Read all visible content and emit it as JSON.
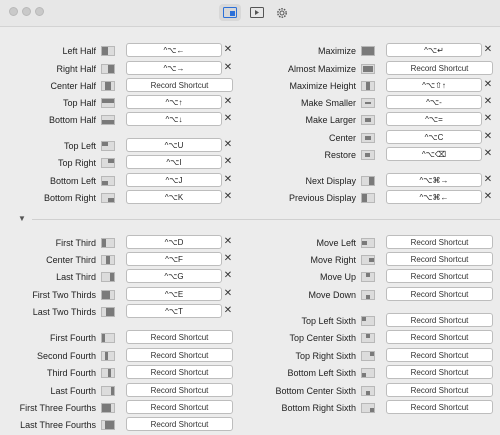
{
  "left_column": [
    {
      "label": "Left Half",
      "icon": "left-half",
      "shortcut": "^⌥←",
      "clearable": true
    },
    {
      "label": "Right Half",
      "icon": "right-half",
      "shortcut": "^⌥→",
      "clearable": true
    },
    {
      "label": "Center Half",
      "icon": "center-half",
      "shortcut": "Record Shortcut",
      "clearable": false
    },
    {
      "label": "Top Half",
      "icon": "top-half",
      "shortcut": "^⌥↑",
      "clearable": true
    },
    {
      "label": "Bottom Half",
      "icon": "bottom-half",
      "shortcut": "^⌥↓",
      "clearable": true
    },
    {
      "label": "Top Left",
      "icon": "top-left",
      "shortcut": "^⌥U",
      "clearable": true
    },
    {
      "label": "Top Right",
      "icon": "top-right",
      "shortcut": "^⌥I",
      "clearable": true
    },
    {
      "label": "Bottom Left",
      "icon": "bottom-left",
      "shortcut": "^⌥J",
      "clearable": true
    },
    {
      "label": "Bottom Right",
      "icon": "bottom-right",
      "shortcut": "^⌥K",
      "clearable": true
    },
    {
      "label": "First Third",
      "icon": "first-third",
      "shortcut": "^⌥D",
      "clearable": true
    },
    {
      "label": "Center Third",
      "icon": "center-third",
      "shortcut": "^⌥F",
      "clearable": true
    },
    {
      "label": "Last Third",
      "icon": "last-third",
      "shortcut": "^⌥G",
      "clearable": true
    },
    {
      "label": "First Two Thirds",
      "icon": "first-two-thirds",
      "shortcut": "^⌥E",
      "clearable": true
    },
    {
      "label": "Last Two Thirds",
      "icon": "last-two-thirds",
      "shortcut": "^⌥T",
      "clearable": true
    },
    {
      "label": "First Fourth",
      "icon": "first-fourth",
      "shortcut": "Record Shortcut",
      "clearable": false
    },
    {
      "label": "Second Fourth",
      "icon": "second-fourth",
      "shortcut": "Record Shortcut",
      "clearable": false
    },
    {
      "label": "Third Fourth",
      "icon": "third-fourth",
      "shortcut": "Record Shortcut",
      "clearable": false
    },
    {
      "label": "Last Fourth",
      "icon": "last-fourth",
      "shortcut": "Record Shortcut",
      "clearable": false
    },
    {
      "label": "First Three Fourths",
      "icon": "first-three-fourths",
      "shortcut": "Record Shortcut",
      "clearable": false
    },
    {
      "label": "Last Three Fourths",
      "icon": "last-three-fourths",
      "shortcut": "Record Shortcut",
      "clearable": false
    }
  ],
  "right_column": [
    {
      "label": "Maximize",
      "icon": "maximize",
      "shortcut": "^⌥↵",
      "clearable": true
    },
    {
      "label": "Almost Maximize",
      "icon": "almost-maximize",
      "shortcut": "Record Shortcut",
      "clearable": false
    },
    {
      "label": "Maximize Height",
      "icon": "maximize-height",
      "shortcut": "^⌥⇧↑",
      "clearable": true
    },
    {
      "label": "Make Smaller",
      "icon": "make-smaller",
      "shortcut": "^⌥-",
      "clearable": true
    },
    {
      "label": "Make Larger",
      "icon": "make-larger",
      "shortcut": "^⌥=",
      "clearable": true
    },
    {
      "label": "Center",
      "icon": "center",
      "shortcut": "^⌥C",
      "clearable": true
    },
    {
      "label": "Restore",
      "icon": "restore",
      "shortcut": "^⌥⌫",
      "clearable": true
    },
    {
      "label": "Next Display",
      "icon": "next-display",
      "shortcut": "^⌥⌘→",
      "clearable": true
    },
    {
      "label": "Previous Display",
      "icon": "previous-display",
      "shortcut": "^⌥⌘←",
      "clearable": true
    },
    {
      "label": "Move Left",
      "icon": "move-left",
      "shortcut": "Record Shortcut",
      "clearable": false
    },
    {
      "label": "Move Right",
      "icon": "move-right",
      "shortcut": "Record Shortcut",
      "clearable": false
    },
    {
      "label": "Move Up",
      "icon": "move-up",
      "shortcut": "Record Shortcut",
      "clearable": false
    },
    {
      "label": "Move Down",
      "icon": "move-down",
      "shortcut": "Record Shortcut",
      "clearable": false
    },
    {
      "label": "Top Left Sixth",
      "icon": "top-left-sixth",
      "shortcut": "Record Shortcut",
      "clearable": false
    },
    {
      "label": "Top Center Sixth",
      "icon": "top-center-sixth",
      "shortcut": "Record Shortcut",
      "clearable": false
    },
    {
      "label": "Top Right Sixth",
      "icon": "top-right-sixth",
      "shortcut": "Record Shortcut",
      "clearable": false
    },
    {
      "label": "Bottom Left Sixth",
      "icon": "bottom-left-sixth",
      "shortcut": "Record Shortcut",
      "clearable": false
    },
    {
      "label": "Bottom Center Sixth",
      "icon": "bottom-center-sixth",
      "shortcut": "Record Shortcut",
      "clearable": false
    },
    {
      "label": "Bottom Right Sixth",
      "icon": "bottom-right-sixth",
      "shortcut": "Record Shortcut",
      "clearable": false
    }
  ],
  "clear_glyph": "✕",
  "toggle_glyph": "▼"
}
